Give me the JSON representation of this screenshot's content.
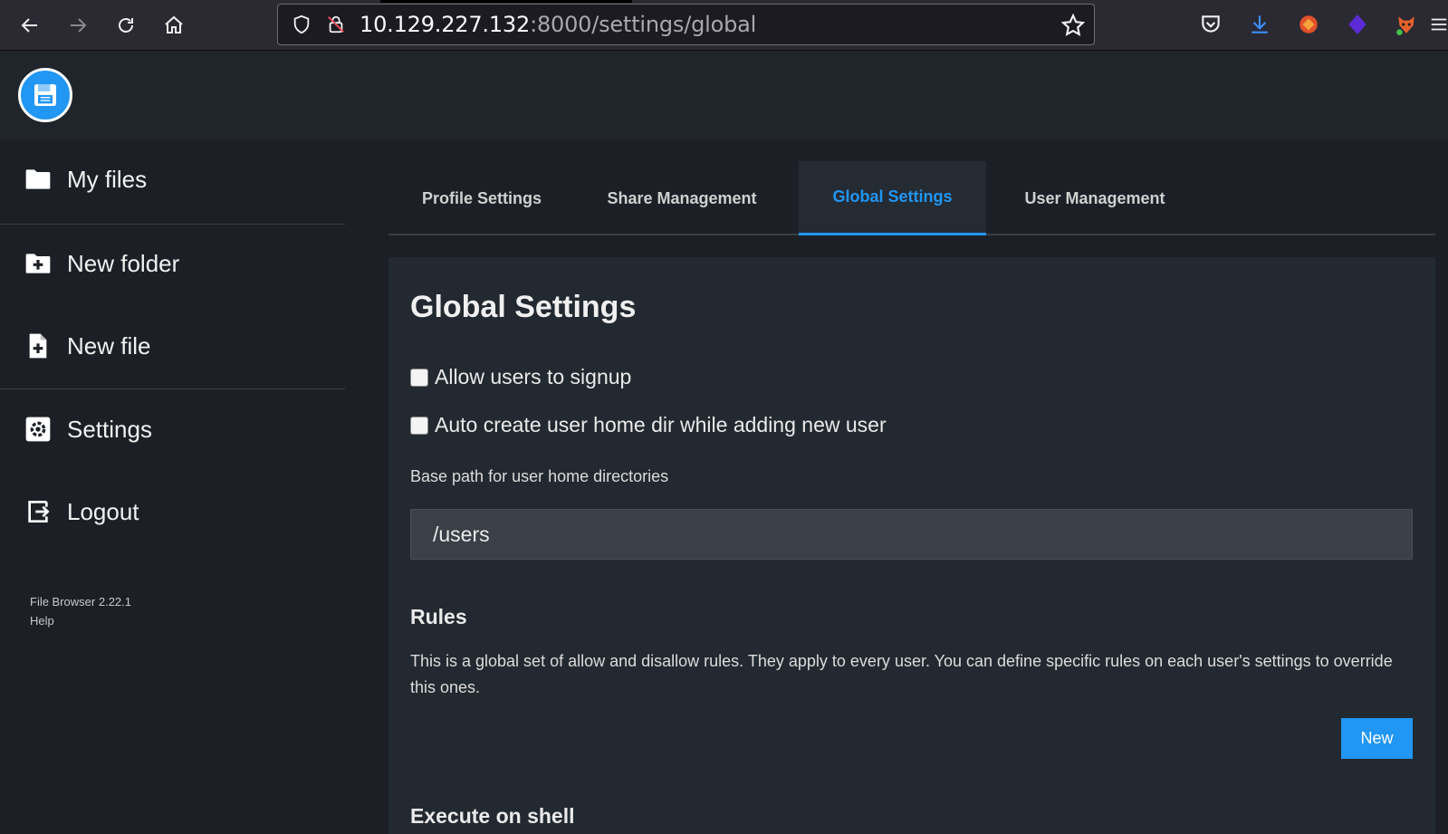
{
  "browser": {
    "url_host": "10.129.227.132",
    "url_path": ":8000/settings/global",
    "icons": [
      "back-arrow-icon",
      "forward-arrow-icon",
      "reload-icon",
      "home-icon",
      "shield-icon",
      "insecure-lock-icon",
      "bookmark-star-icon",
      "pocket-icon",
      "download-icon",
      "extension-icon",
      "menu-icon"
    ]
  },
  "app": {
    "logo_icon": "floppy-disk-icon",
    "accent": "#2196f3"
  },
  "sidebar": {
    "items": [
      {
        "label": "My files",
        "icon": "folder-icon"
      },
      {
        "label": "New folder",
        "icon": "folder-plus-icon"
      },
      {
        "label": "New file",
        "icon": "file-plus-icon"
      },
      {
        "label": "Settings",
        "icon": "gear-icon"
      },
      {
        "label": "Logout",
        "icon": "logout-icon"
      }
    ],
    "footer": {
      "version": "File Browser 2.22.1",
      "help": "Help"
    }
  },
  "tabs": [
    {
      "label": "Profile Settings",
      "active": false
    },
    {
      "label": "Share Management",
      "active": false
    },
    {
      "label": "Global Settings",
      "active": true
    },
    {
      "label": "User Management",
      "active": false
    }
  ],
  "global": {
    "title": "Global Settings",
    "allow_signup_label": "Allow users to signup",
    "auto_create_home_label": "Auto create user home dir while adding new user",
    "base_path_label": "Base path for user home directories",
    "base_path_value": "/users",
    "rules_title": "Rules",
    "rules_description": "This is a global set of allow and disallow rules. They apply to every user. You can define specific rules on each user's settings to override this ones.",
    "new_button": "New",
    "execute_title": "Execute on shell"
  }
}
